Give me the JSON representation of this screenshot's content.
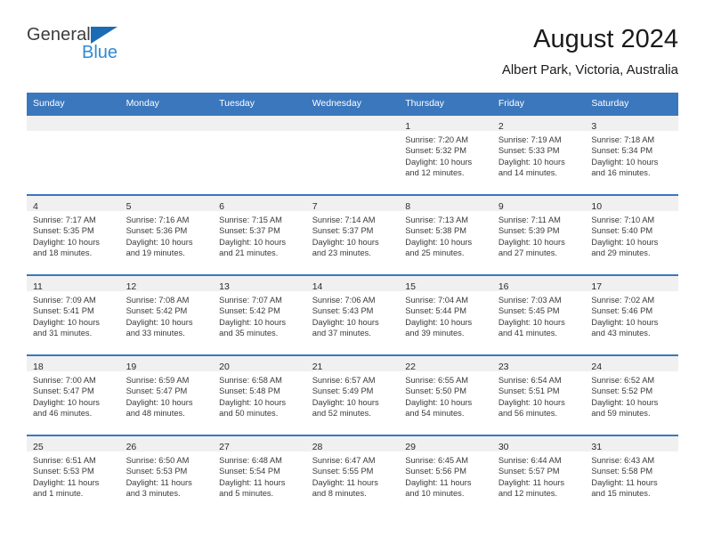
{
  "brand": {
    "name_part1": "General",
    "name_part2": "Blue",
    "logo_icon": "blue-triangle-icon",
    "color_primary": "#1b6cb5",
    "color_secondary": "#2e8ad4"
  },
  "header": {
    "title": "August 2024",
    "subtitle": "Albert Park, Victoria, Australia"
  },
  "theme": {
    "header_blue": "#3b77bd",
    "daynum_band": "#f0f0f0",
    "text": "#3a3a3a"
  },
  "weekday_headers": [
    "Sunday",
    "Monday",
    "Tuesday",
    "Wednesday",
    "Thursday",
    "Friday",
    "Saturday"
  ],
  "weeks": [
    [
      {
        "day": "",
        "lines": [
          "",
          "",
          "",
          ""
        ]
      },
      {
        "day": "",
        "lines": [
          "",
          "",
          "",
          ""
        ]
      },
      {
        "day": "",
        "lines": [
          "",
          "",
          "",
          ""
        ]
      },
      {
        "day": "",
        "lines": [
          "",
          "",
          "",
          ""
        ]
      },
      {
        "day": "1",
        "lines": [
          "Sunrise: 7:20 AM",
          "Sunset: 5:32 PM",
          "Daylight: 10 hours",
          "and 12 minutes."
        ]
      },
      {
        "day": "2",
        "lines": [
          "Sunrise: 7:19 AM",
          "Sunset: 5:33 PM",
          "Daylight: 10 hours",
          "and 14 minutes."
        ]
      },
      {
        "day": "3",
        "lines": [
          "Sunrise: 7:18 AM",
          "Sunset: 5:34 PM",
          "Daylight: 10 hours",
          "and 16 minutes."
        ]
      }
    ],
    [
      {
        "day": "4",
        "lines": [
          "Sunrise: 7:17 AM",
          "Sunset: 5:35 PM",
          "Daylight: 10 hours",
          "and 18 minutes."
        ]
      },
      {
        "day": "5",
        "lines": [
          "Sunrise: 7:16 AM",
          "Sunset: 5:36 PM",
          "Daylight: 10 hours",
          "and 19 minutes."
        ]
      },
      {
        "day": "6",
        "lines": [
          "Sunrise: 7:15 AM",
          "Sunset: 5:37 PM",
          "Daylight: 10 hours",
          "and 21 minutes."
        ]
      },
      {
        "day": "7",
        "lines": [
          "Sunrise: 7:14 AM",
          "Sunset: 5:37 PM",
          "Daylight: 10 hours",
          "and 23 minutes."
        ]
      },
      {
        "day": "8",
        "lines": [
          "Sunrise: 7:13 AM",
          "Sunset: 5:38 PM",
          "Daylight: 10 hours",
          "and 25 minutes."
        ]
      },
      {
        "day": "9",
        "lines": [
          "Sunrise: 7:11 AM",
          "Sunset: 5:39 PM",
          "Daylight: 10 hours",
          "and 27 minutes."
        ]
      },
      {
        "day": "10",
        "lines": [
          "Sunrise: 7:10 AM",
          "Sunset: 5:40 PM",
          "Daylight: 10 hours",
          "and 29 minutes."
        ]
      }
    ],
    [
      {
        "day": "11",
        "lines": [
          "Sunrise: 7:09 AM",
          "Sunset: 5:41 PM",
          "Daylight: 10 hours",
          "and 31 minutes."
        ]
      },
      {
        "day": "12",
        "lines": [
          "Sunrise: 7:08 AM",
          "Sunset: 5:42 PM",
          "Daylight: 10 hours",
          "and 33 minutes."
        ]
      },
      {
        "day": "13",
        "lines": [
          "Sunrise: 7:07 AM",
          "Sunset: 5:42 PM",
          "Daylight: 10 hours",
          "and 35 minutes."
        ]
      },
      {
        "day": "14",
        "lines": [
          "Sunrise: 7:06 AM",
          "Sunset: 5:43 PM",
          "Daylight: 10 hours",
          "and 37 minutes."
        ]
      },
      {
        "day": "15",
        "lines": [
          "Sunrise: 7:04 AM",
          "Sunset: 5:44 PM",
          "Daylight: 10 hours",
          "and 39 minutes."
        ]
      },
      {
        "day": "16",
        "lines": [
          "Sunrise: 7:03 AM",
          "Sunset: 5:45 PM",
          "Daylight: 10 hours",
          "and 41 minutes."
        ]
      },
      {
        "day": "17",
        "lines": [
          "Sunrise: 7:02 AM",
          "Sunset: 5:46 PM",
          "Daylight: 10 hours",
          "and 43 minutes."
        ]
      }
    ],
    [
      {
        "day": "18",
        "lines": [
          "Sunrise: 7:00 AM",
          "Sunset: 5:47 PM",
          "Daylight: 10 hours",
          "and 46 minutes."
        ]
      },
      {
        "day": "19",
        "lines": [
          "Sunrise: 6:59 AM",
          "Sunset: 5:47 PM",
          "Daylight: 10 hours",
          "and 48 minutes."
        ]
      },
      {
        "day": "20",
        "lines": [
          "Sunrise: 6:58 AM",
          "Sunset: 5:48 PM",
          "Daylight: 10 hours",
          "and 50 minutes."
        ]
      },
      {
        "day": "21",
        "lines": [
          "Sunrise: 6:57 AM",
          "Sunset: 5:49 PM",
          "Daylight: 10 hours",
          "and 52 minutes."
        ]
      },
      {
        "day": "22",
        "lines": [
          "Sunrise: 6:55 AM",
          "Sunset: 5:50 PM",
          "Daylight: 10 hours",
          "and 54 minutes."
        ]
      },
      {
        "day": "23",
        "lines": [
          "Sunrise: 6:54 AM",
          "Sunset: 5:51 PM",
          "Daylight: 10 hours",
          "and 56 minutes."
        ]
      },
      {
        "day": "24",
        "lines": [
          "Sunrise: 6:52 AM",
          "Sunset: 5:52 PM",
          "Daylight: 10 hours",
          "and 59 minutes."
        ]
      }
    ],
    [
      {
        "day": "25",
        "lines": [
          "Sunrise: 6:51 AM",
          "Sunset: 5:53 PM",
          "Daylight: 11 hours",
          "and 1 minute."
        ]
      },
      {
        "day": "26",
        "lines": [
          "Sunrise: 6:50 AM",
          "Sunset: 5:53 PM",
          "Daylight: 11 hours",
          "and 3 minutes."
        ]
      },
      {
        "day": "27",
        "lines": [
          "Sunrise: 6:48 AM",
          "Sunset: 5:54 PM",
          "Daylight: 11 hours",
          "and 5 minutes."
        ]
      },
      {
        "day": "28",
        "lines": [
          "Sunrise: 6:47 AM",
          "Sunset: 5:55 PM",
          "Daylight: 11 hours",
          "and 8 minutes."
        ]
      },
      {
        "day": "29",
        "lines": [
          "Sunrise: 6:45 AM",
          "Sunset: 5:56 PM",
          "Daylight: 11 hours",
          "and 10 minutes."
        ]
      },
      {
        "day": "30",
        "lines": [
          "Sunrise: 6:44 AM",
          "Sunset: 5:57 PM",
          "Daylight: 11 hours",
          "and 12 minutes."
        ]
      },
      {
        "day": "31",
        "lines": [
          "Sunrise: 6:43 AM",
          "Sunset: 5:58 PM",
          "Daylight: 11 hours",
          "and 15 minutes."
        ]
      }
    ]
  ]
}
